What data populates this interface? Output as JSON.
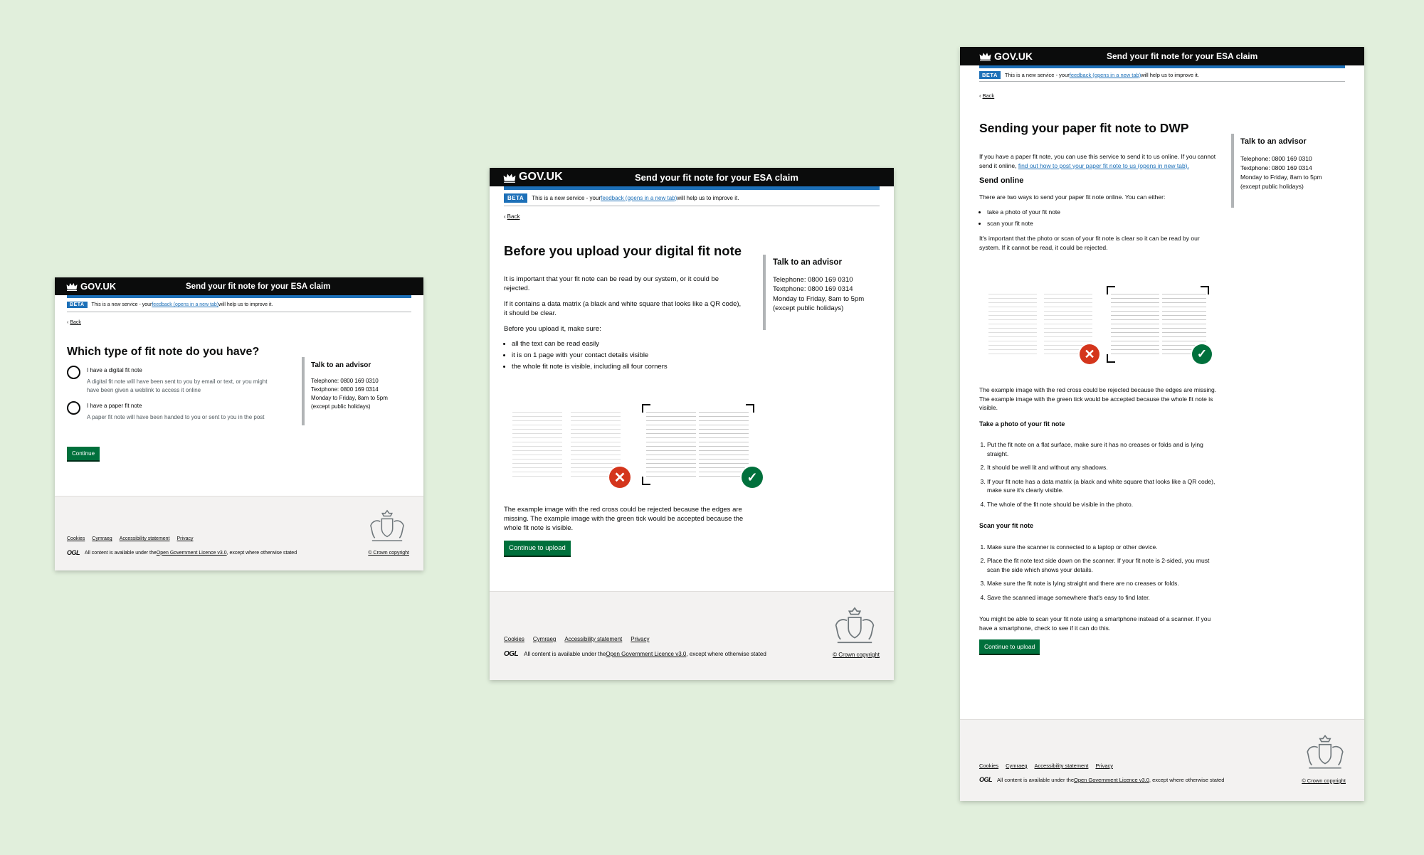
{
  "brand": "GOV.UK",
  "service_name": "Send your fit note for your ESA claim",
  "beta": {
    "tag": "BETA",
    "before": "This is a new service - your ",
    "link": "feedback (opens in a new tab)",
    "after": " will help us to improve it."
  },
  "back": "Back",
  "advisor": {
    "title": "Talk to an advisor",
    "telephone": "Telephone: 0800 169 0310",
    "textphone": "Textphone: 0800 169 0314",
    "hours": "Monday to Friday, 8am to 5pm",
    "hours_note": "(except public holidays)"
  },
  "footer": {
    "links": [
      "Cookies",
      "Cymraeg",
      "Accessibility statement",
      "Privacy"
    ],
    "ogl_logo": "OGL",
    "licence_before": "All content is available under the ",
    "licence_link": "Open Government Licence v3.0",
    "licence_after": ", except where otherwise stated",
    "copyright": "© Crown copyright"
  },
  "screen1": {
    "heading": "Which type of fit note do you have?",
    "options": [
      {
        "label": "I have a digital fit note",
        "hint": "A digital fit note will have been sent to you by email or text, or you might have been given a weblink to access it online"
      },
      {
        "label": "I have a paper fit note",
        "hint": "A paper fit note will have been handed to you or sent to you in the post"
      }
    ],
    "button": "Continue"
  },
  "screen2": {
    "heading": "Before you upload your digital fit note",
    "p1": "It is important that your fit note can be read by our system, or it could be rejected.",
    "p2": "If it contains a data matrix (a black and white square that looks like a QR code), it should be clear.",
    "p3": "Before you upload it, make sure:",
    "bullets": [
      "all the text can be read easily",
      "it is on 1 page with your contact details visible",
      "the whole fit note is visible, including all four corners"
    ],
    "caption": "The example image with the red cross could be rejected because the edges are missing. The example image with the green tick would be accepted because the whole fit note is visible.",
    "button": "Continue to upload"
  },
  "screen3": {
    "heading": "Sending your paper fit note to DWP",
    "intro_before": "If you have a paper fit note, you can use this service to send it to us online. If you cannot send it online, ",
    "intro_link": "find out how to post your paper fit note to us (opens in new tab).",
    "send_online": "Send online",
    "ways": "There are two ways to send your paper fit note online. You can either:",
    "ways_list": [
      "take a photo of your fit note",
      "scan your fit note"
    ],
    "important": "It's important that the photo or scan of your fit note is clear so it can be read by our system. If it cannot be read, it could be rejected.",
    "caption": "The example image with the red cross could be rejected because the edges are missing. The example image with the green tick would be accepted because the whole fit note is visible.",
    "photo_heading": "Take a photo of your fit note",
    "photo_steps": [
      "Put the fit note on a flat surface, make sure it has no creases or folds and is lying straight.",
      "It should be well lit and without any shadows.",
      "If your fit note has a data matrix (a black and white square that looks like a QR code), make sure it's clearly visible.",
      "The whole of the fit note should be visible in the photo."
    ],
    "scan_heading": "Scan your fit note",
    "scan_steps": [
      "Make sure the scanner is connected to a laptop or other device.",
      "Place the fit note text side down on the scanner. If your fit note is 2-sided, you must scan the side which shows your details.",
      "Make sure the fit note is lying straight and there are no creases or folds.",
      "Save the scanned image somewhere that's easy to find later."
    ],
    "smartphone": "You might be able to scan your fit note using a smartphone instead of a scanner. If you have a smartphone, check to see if it can do this.",
    "button": "Continue to upload"
  }
}
